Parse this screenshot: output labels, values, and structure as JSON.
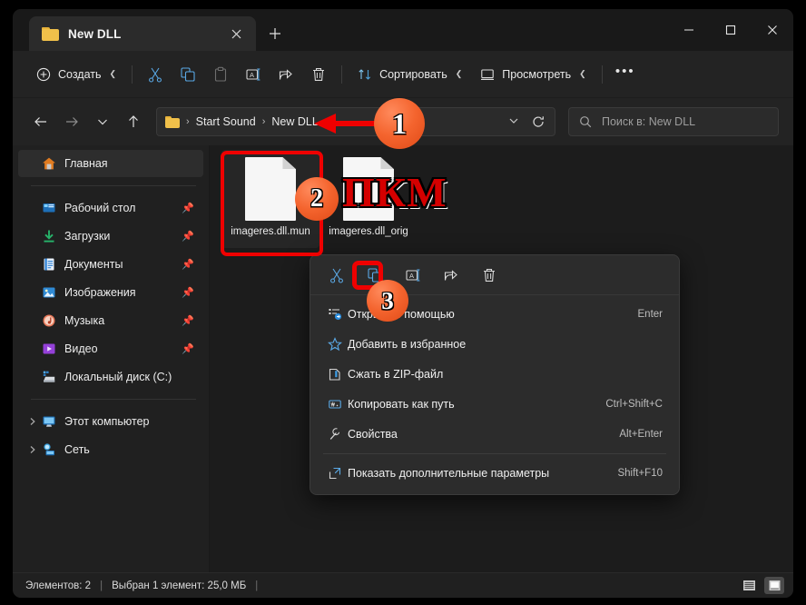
{
  "window": {
    "tab_title": "New DLL",
    "tab_close_icon": "close-icon",
    "new_tab_icon": "plus-icon",
    "minimize_label": "—",
    "maximize_label": "□",
    "close_label": "✕"
  },
  "toolbar": {
    "new_label": "Создать",
    "cut_icon": "scissors-icon",
    "copy_icon": "copy-icon",
    "paste_icon": "paste-icon",
    "rename_icon": "rename-icon",
    "share_icon": "share-icon",
    "delete_icon": "trash-icon",
    "sort_label": "Сортировать",
    "view_label": "Просмотреть",
    "more_label": "•••"
  },
  "address": {
    "back_icon": "arrow-left-icon",
    "forward_icon": "arrow-right-icon",
    "recent_icon": "chevron-down-icon",
    "up_icon": "arrow-up-icon",
    "folder_icon": "folder-icon",
    "crumbs": [
      "Start Sound",
      "New DLL"
    ],
    "separator": "›",
    "dropdown_icon": "chevron-down-icon",
    "refresh_icon": "refresh-icon",
    "search_icon": "search-icon",
    "search_placeholder": "Поиск в: New DLL"
  },
  "sidebar": {
    "home": {
      "label": "Главная",
      "icon": "home-icon"
    },
    "quick": [
      {
        "label": "Рабочий стол",
        "icon": "desktop-icon",
        "pinned": true
      },
      {
        "label": "Загрузки",
        "icon": "downloads-icon",
        "pinned": true
      },
      {
        "label": "Документы",
        "icon": "documents-icon",
        "pinned": true
      },
      {
        "label": "Изображения",
        "icon": "pictures-icon",
        "pinned": true
      },
      {
        "label": "Музыка",
        "icon": "music-icon",
        "pinned": true
      },
      {
        "label": "Видео",
        "icon": "video-icon",
        "pinned": true
      },
      {
        "label": "Локальный диск (C:)",
        "icon": "drive-icon",
        "pinned": false
      }
    ],
    "tree": [
      {
        "label": "Этот компьютер",
        "icon": "this-pc-icon"
      },
      {
        "label": "Сеть",
        "icon": "network-icon"
      }
    ],
    "pin_icon": "pin-icon",
    "expander_icon": "chevron-right-icon"
  },
  "files": [
    {
      "name": "imageres.dll.mun",
      "icon": "generic-file-icon",
      "selected": true
    },
    {
      "name": "imageres.dll_orig",
      "icon": "generic-file-icon",
      "selected": false
    }
  ],
  "context_menu": {
    "tools": [
      {
        "name": "cut",
        "icon": "scissors-icon"
      },
      {
        "name": "copy",
        "icon": "copy-icon"
      },
      {
        "name": "rename",
        "icon": "rename-icon"
      },
      {
        "name": "share",
        "icon": "share-icon"
      },
      {
        "name": "delete",
        "icon": "trash-icon"
      }
    ],
    "items": [
      {
        "label": "Открыть с помощью",
        "shortcut": "Enter",
        "icon": "open-with-icon"
      },
      {
        "label": "Добавить в избранное",
        "shortcut": "",
        "icon": "star-icon"
      },
      {
        "label": "Сжать в ZIP-файл",
        "shortcut": "",
        "icon": "zip-icon"
      },
      {
        "label": "Копировать как путь",
        "shortcut": "Ctrl+Shift+C",
        "icon": "copy-path-icon"
      },
      {
        "label": "Свойства",
        "shortcut": "Alt+Enter",
        "icon": "wrench-icon"
      },
      {
        "label": "Показать дополнительные параметры",
        "shortcut": "Shift+F10",
        "icon": "more-options-icon"
      }
    ]
  },
  "status": {
    "items_count": "Элементов: 2",
    "selection": "Выбран 1 элемент: 25,0 МБ",
    "separator": "|",
    "list_view_icon": "list-view-icon",
    "large_icons_view_icon": "large-icons-view-icon"
  },
  "annotations": {
    "badge1": "1",
    "badge2": "2",
    "badge3": "3",
    "pkm_text": "ПКМ",
    "accent_color": "#f4642e",
    "highlight_color": "#ef0000"
  }
}
